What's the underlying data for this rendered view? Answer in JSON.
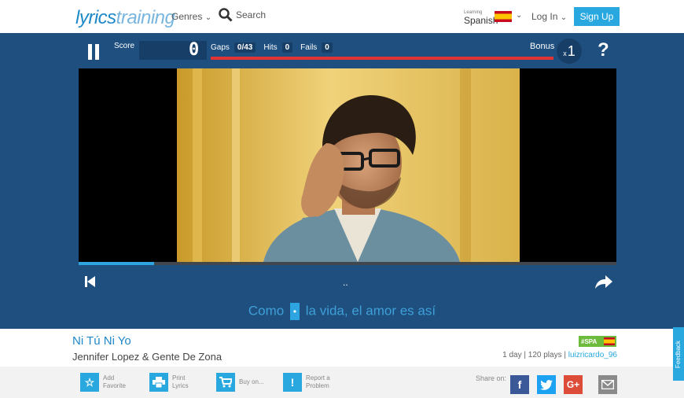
{
  "nav": {
    "logo_part1": "lyrics",
    "logo_part2": "training",
    "genres": "Genres",
    "search": "Search",
    "learning_label": "Learning",
    "language": "Spanish",
    "login": "Log In",
    "signup": "Sign Up"
  },
  "game": {
    "score_label": "Score",
    "score_value": "0",
    "gaps_label": "Gaps",
    "gaps_value": "0/43",
    "hits_label": "Hits",
    "hits_value": "0",
    "fails_label": "Fails",
    "fails_value": "0",
    "bonus_label": "Bonus",
    "bonus_prefix": "x",
    "bonus_value": "1",
    "help": "?",
    "timeline_progress": 0.14
  },
  "lyric": {
    "before": "Como",
    "gap": "•",
    "after": "la vida, el amor es así",
    "dots": ".."
  },
  "song": {
    "title": "Ni Tú Ni Yo",
    "artist": "Jennifer Lopez & Gente De Zona",
    "badge": "#SPA",
    "age": "1 day",
    "plays": "120 plays",
    "user": "luizricardo_96"
  },
  "actions": {
    "favorite": [
      "Add",
      "Favorite"
    ],
    "print": [
      "Print",
      "Lyrics"
    ],
    "buy": [
      "Buy on..."
    ],
    "report": [
      "Report a",
      "Problem"
    ],
    "share_label": "Share on:"
  },
  "feedback": "Feedback",
  "colors": {
    "panel": "#1e4f7f",
    "accent": "#29a8e0",
    "progress_red": "#e03434"
  }
}
